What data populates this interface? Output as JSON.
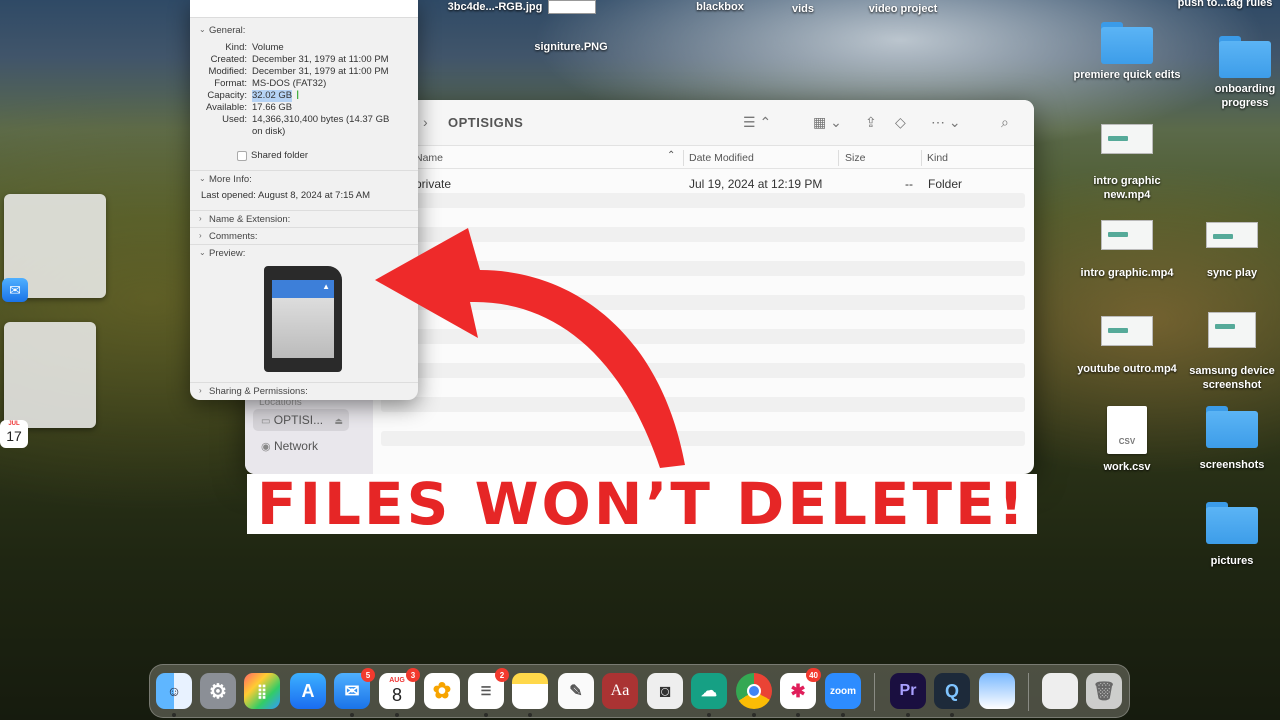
{
  "desktop": {
    "top_items": [
      "3bc4de...-RGB.jpg",
      "blackbox",
      "vids",
      "video project",
      "push to...tag rules",
      "signiture.PNG"
    ],
    "right_items": [
      {
        "label": "premiere quick edits",
        "kind": "folder"
      },
      {
        "label": "onboarding progress",
        "kind": "folder"
      },
      {
        "label": "intro graphic new.mp4",
        "kind": "video"
      },
      {
        "label": "intro graphic.mp4",
        "kind": "video"
      },
      {
        "label": "sync play",
        "kind": "image"
      },
      {
        "label": "youtube outro.mp4",
        "kind": "video"
      },
      {
        "label": "samsung device screenshot",
        "kind": "image"
      },
      {
        "label": "work.csv",
        "kind": "csv",
        "badge": "CSV"
      },
      {
        "label": "screenshots",
        "kind": "folder"
      },
      {
        "label": "pictures",
        "kind": "folder"
      }
    ]
  },
  "finder": {
    "title": "OPTISIGNS",
    "columns": {
      "name": "Name",
      "date": "Date Modified",
      "size": "Size",
      "kind": "Kind"
    },
    "rows": [
      {
        "name": "private",
        "date": "Jul 19, 2024 at 12:19 PM",
        "size": "--",
        "kind": "Folder"
      }
    ],
    "sidebar": {
      "section": "Locations",
      "items": [
        "OPTISI...",
        "Network"
      ]
    }
  },
  "info": {
    "general_title": "General:",
    "fields": [
      {
        "k": "Kind:",
        "v": "Volume"
      },
      {
        "k": "Created:",
        "v": "December 31, 1979 at 11:00 PM"
      },
      {
        "k": "Modified:",
        "v": "December 31, 1979 at 11:00 PM"
      },
      {
        "k": "Format:",
        "v": "MS-DOS (FAT32)"
      },
      {
        "k": "Capacity:",
        "v": "32.02 GB"
      },
      {
        "k": "Available:",
        "v": "17.66 GB"
      },
      {
        "k": "Used:",
        "v": "14,366,310,400 bytes (14.37 GB"
      },
      {
        "k": "",
        "v": "on disk)"
      }
    ],
    "shared_folder": "Shared folder",
    "more_info_title": "More Info:",
    "last_opened": "Last opened: August 8, 2024 at 7:15 AM",
    "sections": [
      "Name & Extension:",
      "Comments:",
      "Preview:",
      "Sharing & Permissions:"
    ]
  },
  "banner": {
    "text": "FILES WON’T DELETE!",
    "color": "#e62626"
  },
  "calendar_widget": {
    "month": "JUL",
    "day": "17"
  },
  "dock": {
    "mail_badge": "5",
    "calendar": {
      "month": "AUG",
      "day": "8",
      "badge": "3"
    },
    "reminders_badge": "2",
    "slack_badge": "40",
    "dictionary_label": "Aa",
    "zoom_label": "zoom",
    "premiere_label": "Pr"
  }
}
